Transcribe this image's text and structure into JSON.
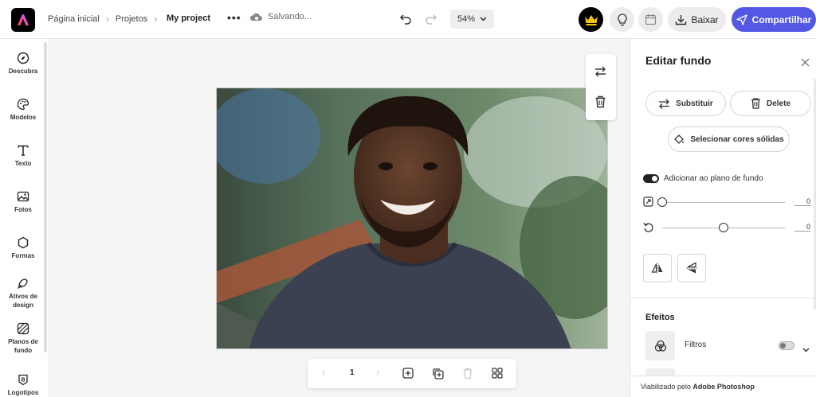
{
  "header": {
    "breadcrumbs": [
      "Página inicial",
      "Projetos"
    ],
    "project_name": "My project",
    "more": "•••",
    "status": "Salvando...",
    "zoom": "54%",
    "download_label": "Baixar",
    "share_label": "Compartilhar"
  },
  "sidebar": {
    "items": [
      {
        "label": "Descubra",
        "icon": "compass-icon"
      },
      {
        "label": "Modelos",
        "icon": "palette-icon"
      },
      {
        "label": "Texto",
        "icon": "text-icon"
      },
      {
        "label": "Fotos",
        "icon": "image-icon"
      },
      {
        "label": "Formas",
        "icon": "shapes-icon"
      },
      {
        "label": "Ativos de design",
        "icon": "assets-icon"
      },
      {
        "label": "Planos de fundo",
        "icon": "background-icon"
      },
      {
        "label": "Logotipos",
        "icon": "logo-icon"
      }
    ]
  },
  "canvas": {
    "page_number": "1"
  },
  "panel": {
    "title": "Editar fundo",
    "replace_label": "Substituir",
    "delete_label": "Delete",
    "select_colors_label": "Selecionar cores sólidas",
    "add_to_background_label": "Adicionar ao plano de fundo",
    "scale_value": "0",
    "rotation_value": "0",
    "scale_fraction": 0.0,
    "rotation_fraction": 0.5,
    "effects_title": "Efeitos",
    "filters_label": "Filtros",
    "footer_prefix": "Viabilizado pelo",
    "footer_brand": "Adobe Photoshop"
  },
  "colors": {
    "accent": "#5258e4",
    "dark": "#000000"
  }
}
